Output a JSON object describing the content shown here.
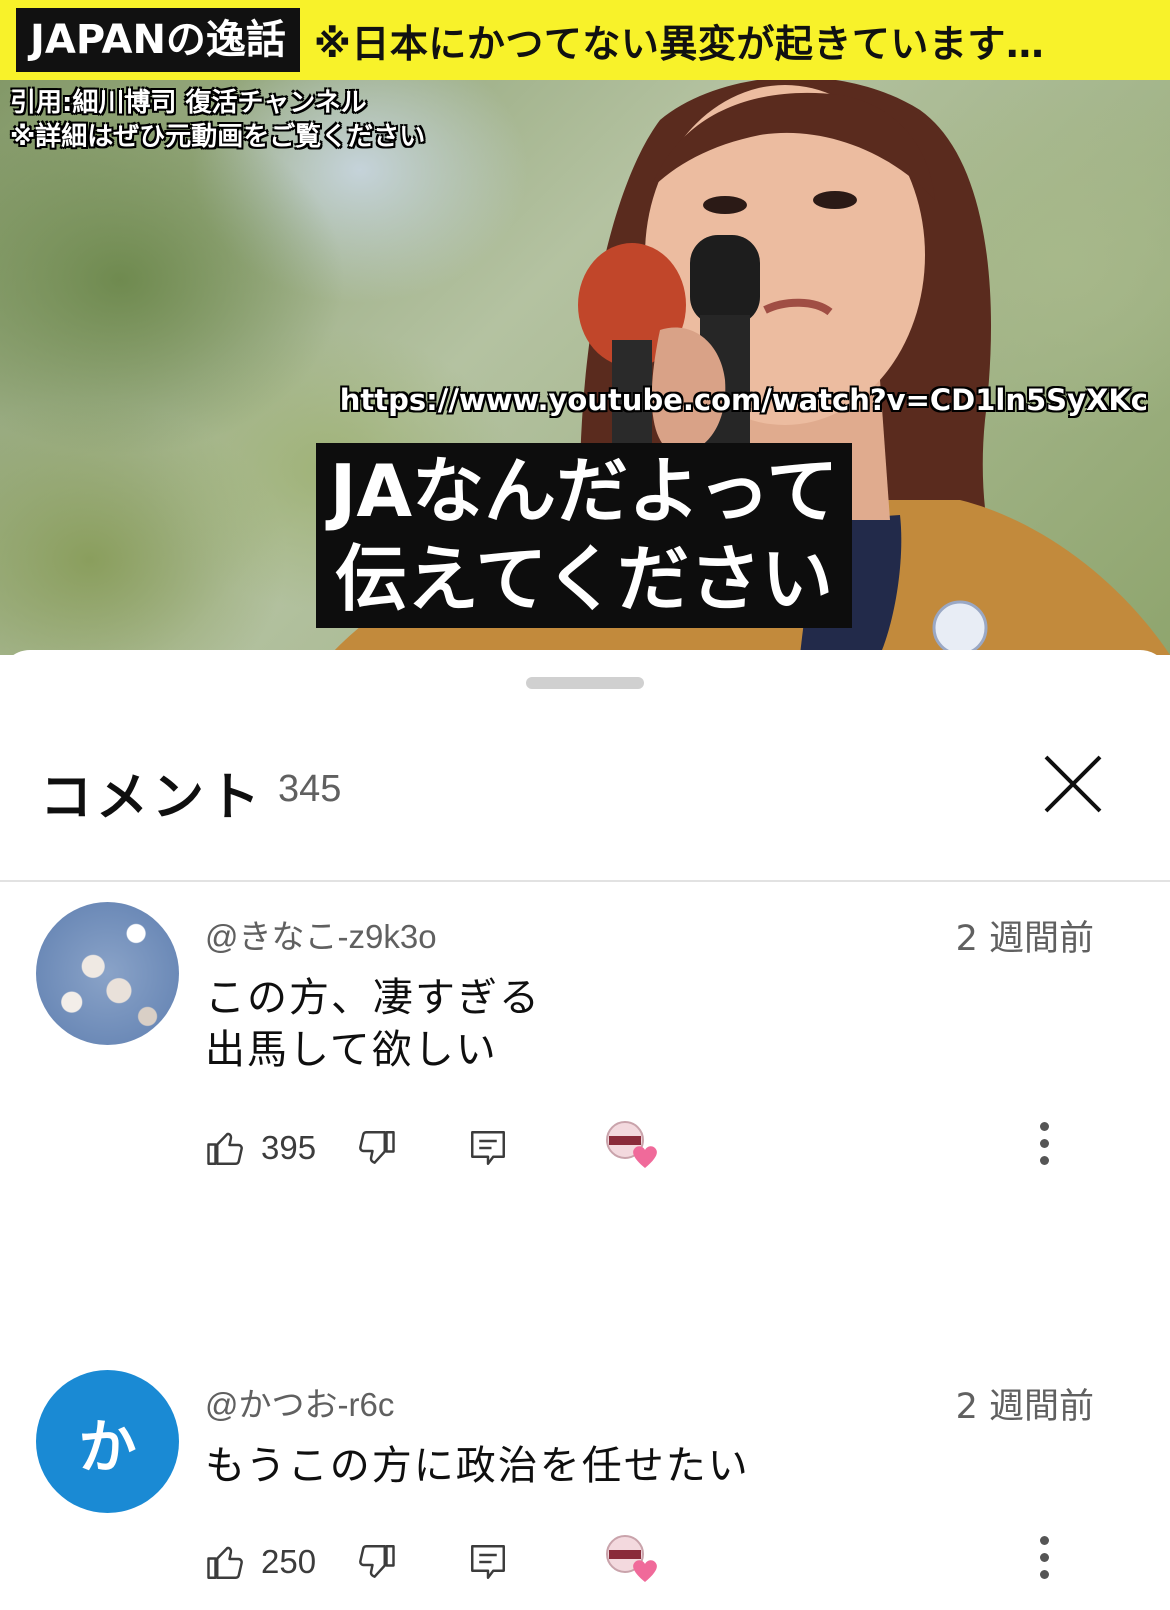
{
  "video": {
    "channel_label": "JAPANの逸話",
    "title": "※日本にかつてない異変が起きています…",
    "credit_line1": "引用:細川博司 復活チャンネル",
    "credit_line2": "※詳細はぜひ元動画をご覧ください",
    "url": "https://www.youtube.com/watch?v=CD1ln5SyXKc",
    "caption_line1": "JAなんだよって",
    "caption_line2": "伝えてください"
  },
  "comments_panel": {
    "title": "コメント",
    "count": "345",
    "close_icon": "close-icon"
  },
  "comments": [
    {
      "author": "@きなこ-z9k3o",
      "time": "2 週間前",
      "text": "この方、凄すぎる\n出馬して欲しい",
      "likes": "395",
      "avatar": "cherry-blossom-photo"
    },
    {
      "author": "@かつお-r6c",
      "time": "2 週間前",
      "text": "もうこの方に政治を任せたい",
      "likes": "250",
      "avatar_letter": "か"
    }
  ],
  "colors": {
    "title_bar": "#f8f22a",
    "avatar_blue": "#1a8ad4",
    "heart": "#f06a9a"
  }
}
